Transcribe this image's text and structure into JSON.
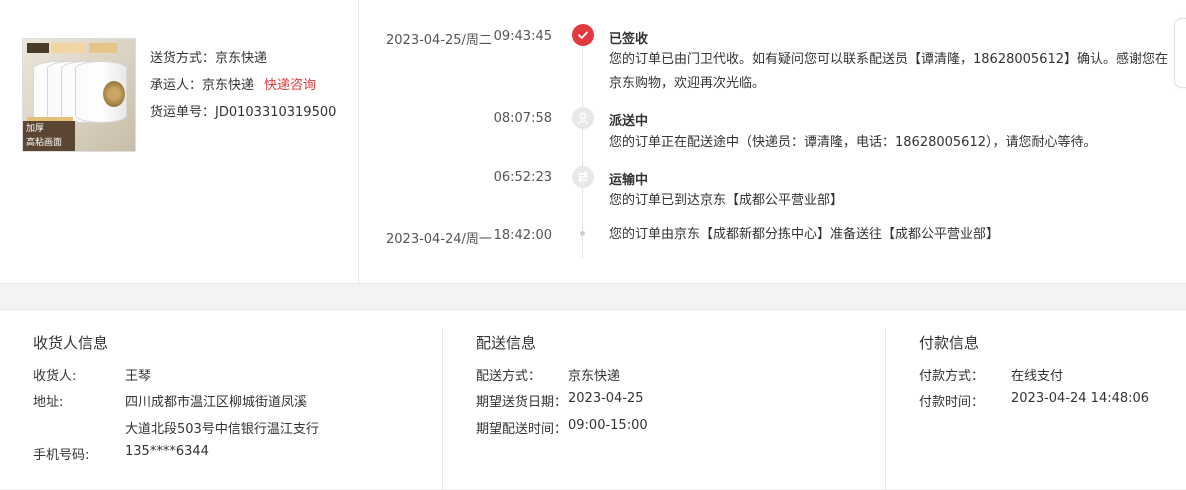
{
  "shipping": {
    "method_label": "送货方式：",
    "method_value": "京东快递",
    "carrier_label": "承运人：",
    "carrier_value": "京东快递",
    "carrier_link": "快递咨询",
    "tracking_label": "货运单号：",
    "tracking_value": "JD0103310319500"
  },
  "product_image": {
    "badge_text": "加厚\n高粘画面"
  },
  "timeline": [
    {
      "date": "2023-04-25/周二",
      "time": "09:43:45",
      "icon": "check-icon",
      "title": "已签收",
      "desc": "您的订单已由门卫代收。如有疑问您可以联系配送员【谭清隆，18628005612】确认。感谢您在京东购物，欢迎再次光临。"
    },
    {
      "date": "",
      "time": "08:07:58",
      "icon": "delivery-person-icon",
      "title": "派送中",
      "desc": "您的订单正在配送途中（快递员：谭清隆，电话：18628005612），请您耐心等待。"
    },
    {
      "date": "",
      "time": "06:52:23",
      "icon": "truck-icon",
      "title": "运输中",
      "desc": "您的订单已到达京东【成都公平营业部】"
    },
    {
      "date": "2023-04-24/周一",
      "time": "18:42:00",
      "icon": "dot",
      "title": "",
      "desc": "您的订单由京东【成都新都分拣中心】准备送往【成都公平营业部】"
    }
  ],
  "receiver": {
    "title": "收货人信息",
    "name_label": "收货人:",
    "name_value": "王琴",
    "address_label": "地址:",
    "address_line1": "四川成都市温江区柳城街道凤溪",
    "address_line2": "大道北段503号中信银行温江支行",
    "phone_label": "手机号码:",
    "phone_value": "135****6344"
  },
  "delivery": {
    "title": "配送信息",
    "method_label": "配送方式：",
    "method_value": "京东快递",
    "date_label": "期望送货日期：",
    "date_value": "2023-04-25",
    "time_label": "期望配送时间：",
    "time_value": "09:00-15:00"
  },
  "payment": {
    "title": "付款信息",
    "method_label": "付款方式：",
    "method_value": "在线支付",
    "time_label": "付款时间：",
    "time_value": "2023-04-24 14:48:06"
  },
  "colors": {
    "accent": "#e4393c",
    "text": "#333333",
    "muted": "#555555",
    "divider": "#e6e6e6",
    "page_bg": "#f3f3f3"
  }
}
